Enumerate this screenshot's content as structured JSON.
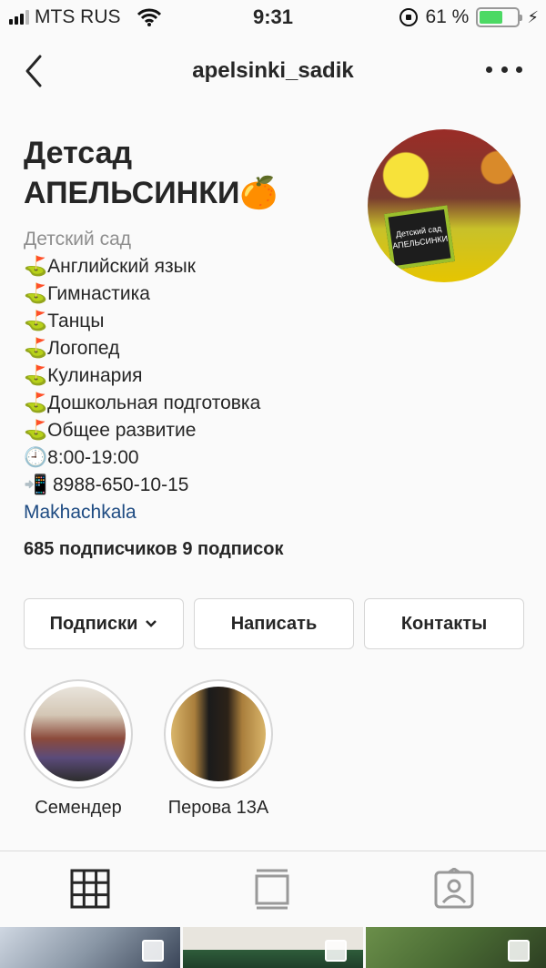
{
  "status_bar": {
    "carrier": "MTS RUS",
    "time": "9:31",
    "battery_percent": "61 %",
    "battery_level": 0.61,
    "icons": [
      "signal-icon",
      "wifi-icon",
      "orientation-lock-icon",
      "battery-icon",
      "charging-icon"
    ]
  },
  "header": {
    "username": "apelsinki_sadik"
  },
  "profile": {
    "name_line1": "Детсад",
    "name_line2": "АПЕЛЬСИНКИ🍊",
    "category": "Детский сад",
    "bio_lines": [
      "⛳Английский язык",
      "⛳Гимнастика",
      "⛳Танцы",
      "⛳Логопед",
      "⛳Кулинария",
      "⛳Дошкольная подготовка",
      "⛳Общее развитие",
      "🕘8:00-19:00",
      "📲 8988-650-10-15"
    ],
    "location": "Makhachkala",
    "stats": "685 подписчиков  9 подписок",
    "avatar_board_text": "Детский сад АПЕЛЬСИНКИ"
  },
  "buttons": {
    "following": "Подписки",
    "message": "Написать",
    "contacts": "Контакты"
  },
  "highlights": [
    {
      "label": "Семендер"
    },
    {
      "label": "Перова 13А"
    }
  ],
  "tabs": [
    "grid-tab",
    "feed-tab",
    "tagged-tab"
  ]
}
